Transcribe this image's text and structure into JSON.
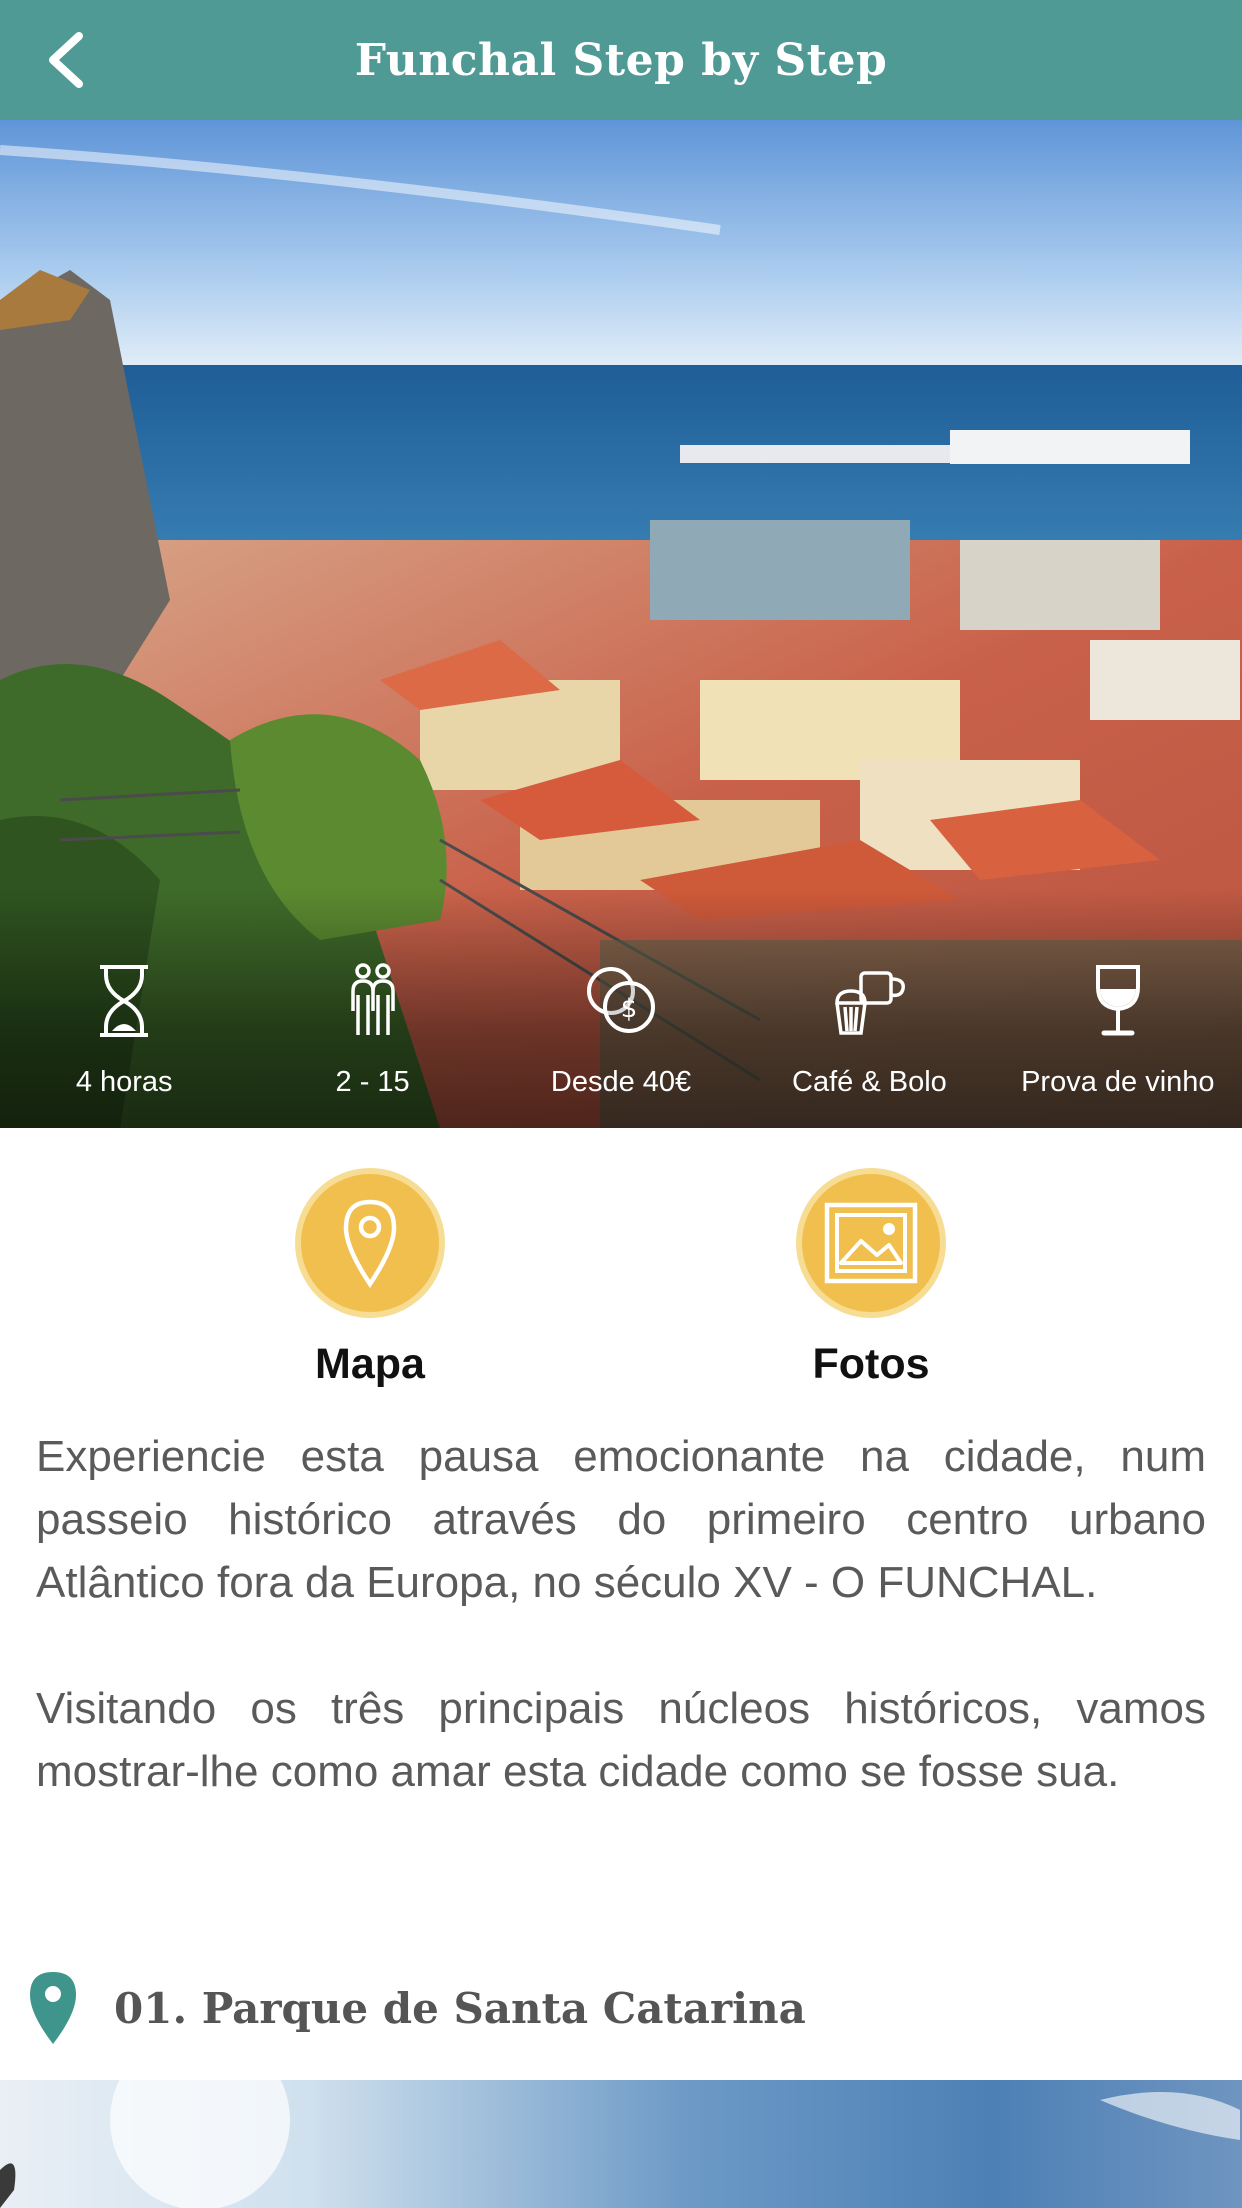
{
  "header": {
    "title": "Funchal Step by Step",
    "back_icon": "chevron-left-icon"
  },
  "features": [
    {
      "icon": "hourglass-icon",
      "label": "4 horas"
    },
    {
      "icon": "people-icon",
      "label": "2 - 15"
    },
    {
      "icon": "coins-icon",
      "label": "Desde 40€"
    },
    {
      "icon": "coffee-cake-icon",
      "label": "Café & Bolo"
    },
    {
      "icon": "wine-glass-icon",
      "label": "Prova de vinho"
    }
  ],
  "actions": {
    "map": {
      "label": "Mapa",
      "icon": "map-pin-icon"
    },
    "photos": {
      "label": "Fotos",
      "icon": "photo-icon"
    }
  },
  "description": {
    "p1": "Experiencie esta pausa emocionante na cidade, num passeio histórico através do primeiro centro urbano Atlântico fora da Europa, no século XV - O FUNCHAL.",
    "p2": "Visitando os três principais núcleos históricos, vamos mostrar-lhe como amar esta cidade como se fosse sua."
  },
  "stops": [
    {
      "title": "01. Parque de Santa Catarina"
    }
  ],
  "colors": {
    "header": "#4f9a94",
    "accent_circle": "#f1bf4d",
    "pin": "#3f948c"
  }
}
